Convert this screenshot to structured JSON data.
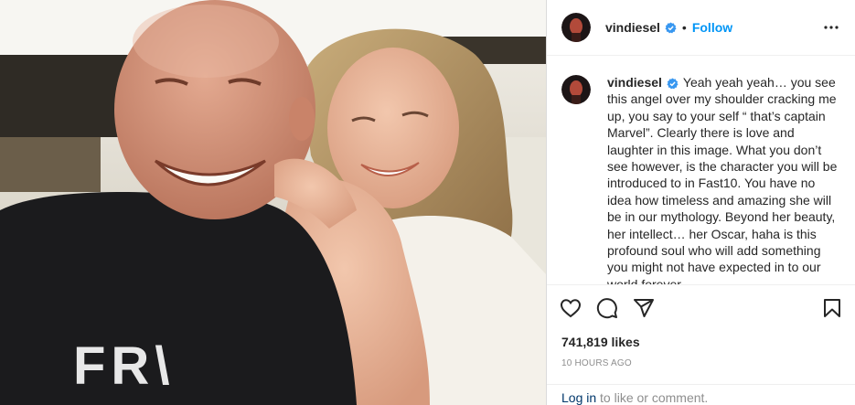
{
  "post": {
    "username": "vindiesel",
    "follow_label": "Follow",
    "separator": "•",
    "caption": "Yeah yeah yeah… you see this angel over my shoulder cracking me up, you say to your self “ that’s captain Marvel”. Clearly there is love and laughter in this image. What you don’t see however, is the character you will be introduced to in Fast10. You have no idea how timeless and amazing she will be in our mythology. Beyond her beauty, her intellect… her Oscar, haha is this profound soul who will add something you might not have expected in to our world forever.",
    "likes": "741,819 likes",
    "time": "10 HOURS AGO",
    "login_link": "Log in",
    "login_rest": " to like or comment.",
    "photo_shirt_text": "FR\\"
  },
  "icons": {
    "verified": "verified-badge-icon",
    "more": "more-options-icon",
    "like": "heart-icon",
    "comment": "comment-icon",
    "share": "paper-plane-icon",
    "save": "bookmark-icon"
  },
  "colors": {
    "link_blue": "#0095f6",
    "verified_blue": "#3897f0",
    "muted": "#8e8e8e",
    "text": "#262626",
    "login_link": "#00376b"
  }
}
